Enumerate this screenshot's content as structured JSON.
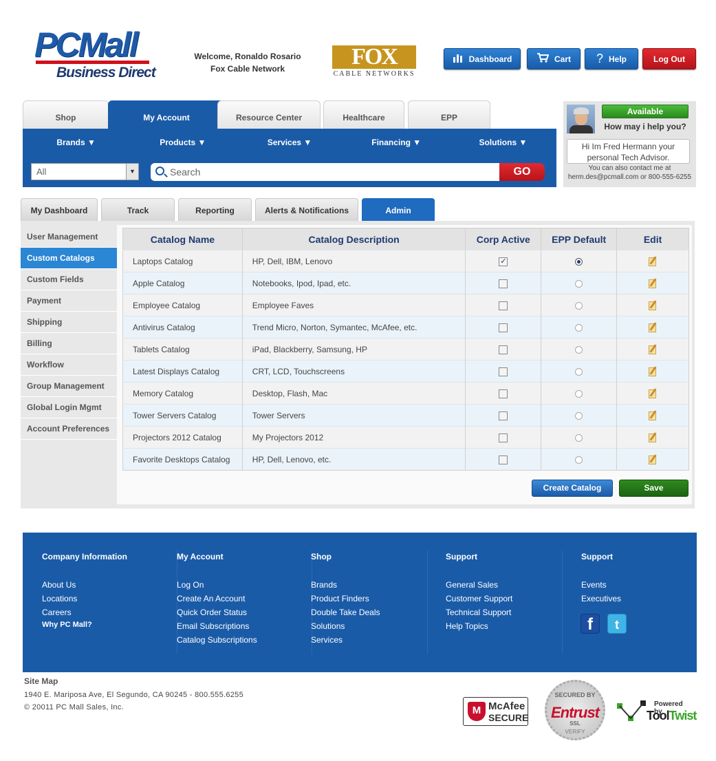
{
  "header": {
    "logo_main": "PCMall",
    "logo_sub": "Business Direct",
    "welcome_line1": "Welcome, Ronaldo Rosario",
    "welcome_line2": "Fox Cable Network",
    "partner_logo": "FOX",
    "partner_sub": "CABLE NETWORKS",
    "buttons": {
      "dashboard": "Dashboard",
      "cart": "Cart",
      "help": "Help",
      "logout": "Log Out"
    }
  },
  "nav": {
    "tabs": [
      "Shop",
      "My Account",
      "Resource Center",
      "Healthcare",
      "EPP"
    ],
    "active_tab": "My Account",
    "menus": [
      "Brands ▼",
      "Products ▼",
      "Services ▼",
      "Financing ▼",
      "Solutions ▼"
    ],
    "search": {
      "category": "All",
      "placeholder": "Search",
      "go_label": "GO"
    }
  },
  "advisor": {
    "status": "Available",
    "question": "How may i help you?",
    "message": "Hi Im Fred Hermann your personal Tech Advisor.",
    "contact_line1": "You can also contact me at",
    "contact_line2": "herm.des@pcmall.com or 800-555-6255"
  },
  "subtabs": [
    "My Dashboard",
    "Track",
    "Reporting",
    "Alerts & Notifications",
    "Admin"
  ],
  "active_subtab": "Admin",
  "sidebar": [
    "User Management",
    "Custom Catalogs",
    "Custom Fields",
    "Payment",
    "Shipping",
    "Billing",
    "Workflow",
    "Group Management",
    "Global Login Mgmt",
    "Account Preferences"
  ],
  "sidebar_active": "Custom Catalogs",
  "table": {
    "headers": [
      "Catalog Name",
      "Catalog Description",
      "Corp Active",
      "EPP Default",
      "Edit"
    ],
    "rows": [
      {
        "name": "Laptops Catalog",
        "desc": "HP, Dell, IBM, Lenovo",
        "corp_active": true,
        "epp_default": true
      },
      {
        "name": "Apple Catalog",
        "desc": "Notebooks, Ipod, Ipad, etc.",
        "corp_active": false,
        "epp_default": false
      },
      {
        "name": "Employee Catalog",
        "desc": "Employee Faves",
        "corp_active": false,
        "epp_default": false
      },
      {
        "name": "Antivirus Catalog",
        "desc": "Trend Micro, Norton, Symantec, McAfee, etc.",
        "corp_active": false,
        "epp_default": false
      },
      {
        "name": "Tablets Catalog",
        "desc": "iPad, Blackberry, Samsung, HP",
        "corp_active": false,
        "epp_default": false
      },
      {
        "name": "Latest Displays Catalog",
        "desc": "CRT, LCD, Touchscreens",
        "corp_active": false,
        "epp_default": false
      },
      {
        "name": "Memory Catalog",
        "desc": "Desktop, Flash, Mac",
        "corp_active": false,
        "epp_default": false
      },
      {
        "name": "Tower Servers Catalog",
        "desc": "Tower Servers",
        "corp_active": false,
        "epp_default": false
      },
      {
        "name": "Projectors 2012 Catalog",
        "desc": "My Projectors 2012",
        "corp_active": false,
        "epp_default": false
      },
      {
        "name": "Favorite Desktops Catalog",
        "desc": "HP, Dell, Lenovo, etc.",
        "corp_active": false,
        "epp_default": false
      }
    ]
  },
  "actions": {
    "create": "Create Catalog",
    "save": "Save"
  },
  "footer": {
    "columns": [
      {
        "title": "Company Information",
        "links": [
          "About Us",
          "Locations",
          "Careers"
        ],
        "extra": "Why PC Mall?"
      },
      {
        "title": "My Account",
        "links": [
          "Log On",
          "Create An Account",
          "Quick Order Status",
          "Email Subscriptions",
          "Catalog Subscriptions"
        ]
      },
      {
        "title": "Shop",
        "links": [
          "Brands",
          "Product Finders",
          "Double Take Deals",
          "Solutions",
          "Services"
        ]
      },
      {
        "title": "Support",
        "links": [
          "General Sales",
          "Customer Support",
          "Technical Support",
          "Help Topics"
        ]
      },
      {
        "title": "Support",
        "links": [
          "Events",
          "Executives"
        ]
      }
    ],
    "sitemap": "Site Map",
    "address": "1940 E. Mariposa Ave, El Segundo, CA 90245 - 800.555.6255",
    "copyright": "© 20011 PC Mall Sales, Inc.",
    "badges": {
      "mcafee1": "McAfee",
      "mcafee2": "SECURE",
      "entrust_top": "SECURED BY",
      "entrust": "Entrust",
      "entrust_ssl": "SSL",
      "entrust_bottom": "VERIFY",
      "tool_pb": "Powered by",
      "tool_a": "Tool",
      "tool_b": "Twist"
    }
  },
  "colors": {
    "brand_blue": "#1a5ba8",
    "accent_red": "#d0111b",
    "green": "#2b8a1e"
  }
}
